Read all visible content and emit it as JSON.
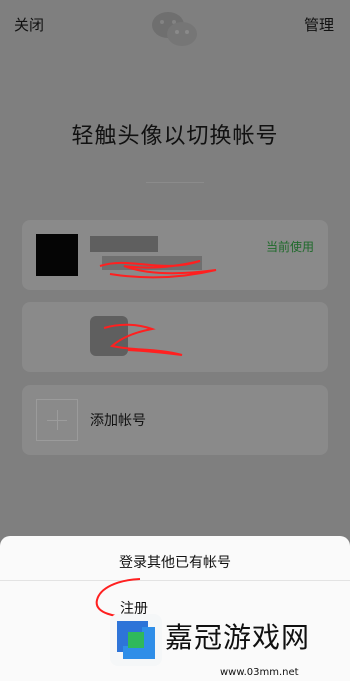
{
  "header": {
    "close_label": "关闭",
    "manage_label": "管理"
  },
  "title": "轻触头像以切换帐号",
  "accounts": [
    {
      "status_label": "当前使用"
    },
    {
      "status_label": ""
    }
  ],
  "add_account_label": "添加帐号",
  "sheet": {
    "title": "登录其他已有帐号",
    "register_label": "注册"
  },
  "watermark": {
    "title": "嘉冠游戏网",
    "url": "www.03mm.net"
  },
  "colors": {
    "overlay": "#7f7f7f",
    "card": "#8a8a8a",
    "accent_text": "#1f6a2b",
    "annotation": "#ff2020"
  },
  "icons": {
    "logo": "wechat-icon",
    "add": "plus-icon"
  }
}
